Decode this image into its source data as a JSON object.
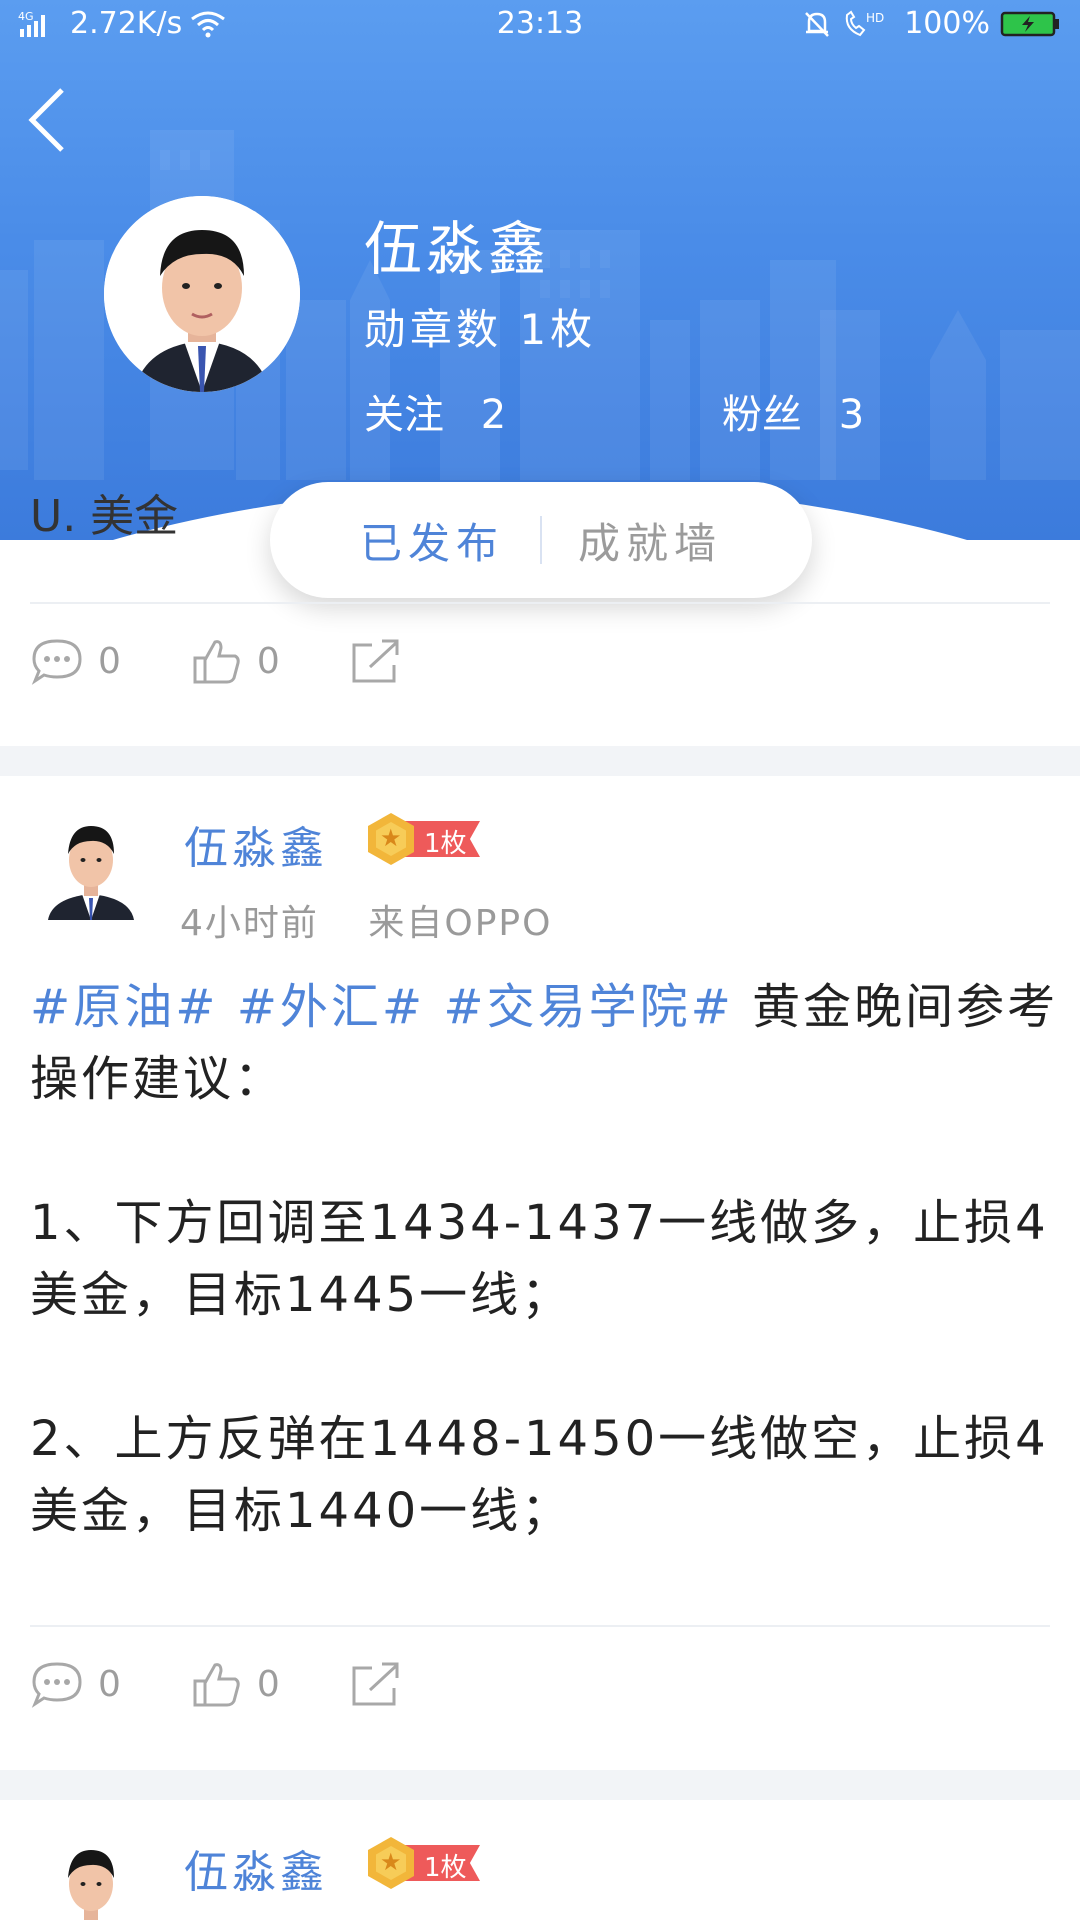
{
  "status_bar": {
    "network": "4G",
    "speed": "2.72K/s",
    "time": "23:13",
    "hd": "HD",
    "battery": "100%"
  },
  "profile": {
    "name": "伍淼鑫",
    "badges": "勋章数 1枚",
    "follow_label": "关注",
    "follow_count": "2",
    "fans_label": "粉丝",
    "fans_count": "3"
  },
  "tabs": {
    "published": "已发布",
    "achievements": "成就墙"
  },
  "previous_post": {
    "cut_text": "U.   美金",
    "comments": "0",
    "likes": "0"
  },
  "post": {
    "author": "伍淼鑫",
    "medal": "1枚",
    "time": "4小时前",
    "source": "来自OPPO",
    "tags": "#原油#  #外汇#  #交易学院#",
    "intro": " 黄金晚间参考操作建议：",
    "line1": "1、下方回调至1434-1437一线做多，止损4美金，目标1445一线；",
    "line2": "2、上方反弹在1448-1450一线做空，止损4美金，目标1440一线；",
    "comments": "0",
    "likes": "0"
  },
  "next_post": {
    "author": "伍淼鑫",
    "medal": "1枚"
  },
  "colors": {
    "header_blue": "#4a8ce8",
    "accent_blue": "#4f84d8",
    "medal_red": "#ee5a5a",
    "medal_gold": "#f2b63a"
  }
}
